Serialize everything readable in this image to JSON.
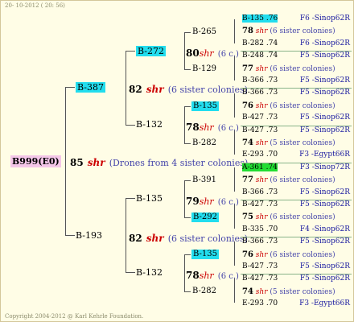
{
  "header": "20- 10-2012 ( 20: 56)",
  "footer": "Copyright 2004-2012 @ Karl Kehrle Foundation.",
  "root": {
    "id": "B999(E0)",
    "num": "85",
    "shr": "shr",
    "note": "(Drones from 4 sister colonies)"
  },
  "g1": [
    {
      "id": "B-387",
      "num": "82",
      "shr": "shr",
      "note": "(6 sister colonies)"
    },
    {
      "id": "B-193",
      "num": "82",
      "shr": "shr",
      "note": "(6 sister colonies)"
    }
  ],
  "g2": [
    {
      "id": "B-272",
      "num": "80",
      "shr": "shr",
      "note": "(6 c.)"
    },
    {
      "id": "B-132",
      "num": "78",
      "shr": "shr",
      "note": "(6 c.)"
    },
    {
      "id": "B-135",
      "num": "79",
      "shr": "shr",
      "note": "(6 c.)"
    },
    {
      "id": "B-132",
      "num": "78",
      "shr": "shr",
      "note": "(6 c.)"
    }
  ],
  "g3": [
    "B-265",
    "B-129",
    "B-135",
    "B-282",
    "B-391",
    "B-292",
    "B-135",
    "B-282"
  ],
  "g4": [
    {
      "a": "B-135 .76",
      "b": "F6 -Sinop62R",
      "hl": "cyan"
    },
    {
      "num": "78",
      "shr": "shr",
      "note": "(6 sister colonies)"
    },
    {
      "a": "B-282 .74",
      "b": "F6 -Sinop62R"
    },
    {
      "a": "B-248 .74",
      "b": "F5 -Sinop62R"
    },
    {
      "num": "77",
      "shr": "shr",
      "note": "(6 sister colonies)"
    },
    {
      "a": "B-366 .73",
      "b": "F5 -Sinop62R"
    },
    {
      "a": "B-366 .73",
      "b": "F5 -Sinop62R"
    },
    {
      "num": "76",
      "shr": "shr",
      "note": "(6 sister colonies)"
    },
    {
      "a": "B-427 .73",
      "b": "F5 -Sinop62R"
    },
    {
      "a": "B-427 .73",
      "b": "F5 -Sinop62R"
    },
    {
      "num": "74",
      "shr": "shr",
      "note": "(5 sister colonies)"
    },
    {
      "a": "E-293 .70",
      "b": "F3 -Egypt66R"
    },
    {
      "a": "A-361 .74",
      "b": "F3 -Sinop72R",
      "hl": "green"
    },
    {
      "num": "77",
      "shr": "shr",
      "note": "(6 sister colonies)"
    },
    {
      "a": "B-366 .73",
      "b": "F5 -Sinop62R"
    },
    {
      "a": "B-427 .73",
      "b": "F5 -Sinop62R"
    },
    {
      "num": "75",
      "shr": "shr",
      "note": "(6 sister colonies)"
    },
    {
      "a": "B-335 .70",
      "b": "F4 -Sinop62R"
    },
    {
      "a": "B-366 .73",
      "b": "F5 -Sinop62R"
    },
    {
      "num": "76",
      "shr": "shr",
      "note": "(6 sister colonies)"
    },
    {
      "a": "B-427 .73",
      "b": "F5 -Sinop62R"
    },
    {
      "a": "B-427 .73",
      "b": "F5 -Sinop62R"
    },
    {
      "num": "74",
      "shr": "shr",
      "note": "(5 sister colonies)"
    },
    {
      "a": "E-293 .70",
      "b": "F3 -Egypt66R"
    }
  ]
}
